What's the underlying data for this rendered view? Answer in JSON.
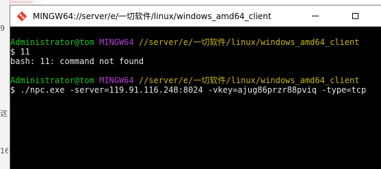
{
  "window": {
    "title": "MINGW64://server/e/一切软件/linux/windows_amd64_client",
    "minimize_icon": "minimize-icon",
    "maximize_icon": "maximize-icon"
  },
  "background_fragments": {
    "left_a": "9",
    "left_b": "这",
    "left_c": "16"
  },
  "terminal": {
    "prompt1": {
      "user": "Administrator@tom",
      "system": "MINGW64",
      "path": "//server/e/一切软件/linux/windows_amd64_client"
    },
    "cmd1": "$ 11",
    "out1": "bash: 11: command not found",
    "prompt2": {
      "user": "Administrator@tom",
      "system": "MINGW64",
      "path": "//server/e/一切软件/linux/windows_amd64_client"
    },
    "cmd2": "$ ./npc.exe -server=119.91.116.248:8024 -vkey=ajug86przr88pviq -type=tcp"
  },
  "colors": {
    "user": "#22c322",
    "system": "#b53dd6",
    "path": "#c8b51e",
    "background": "#000000"
  }
}
